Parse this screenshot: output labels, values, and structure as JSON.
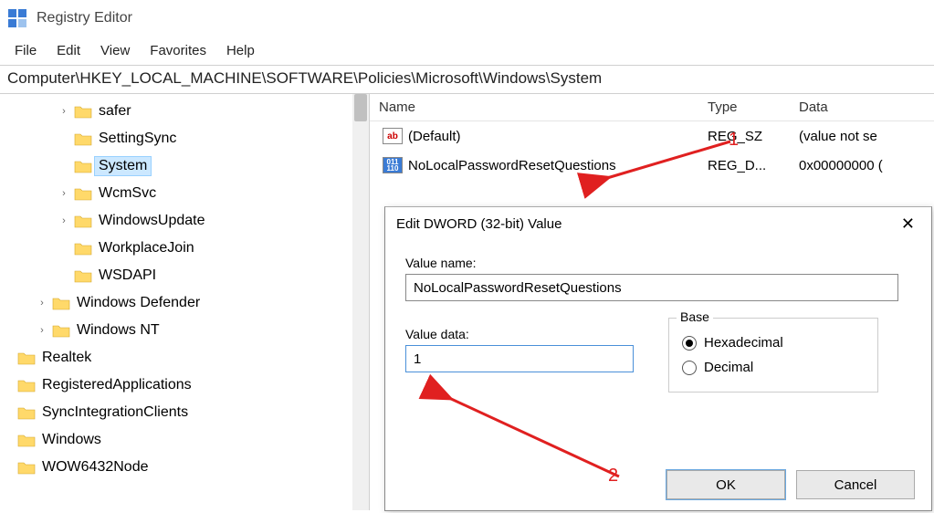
{
  "app": {
    "title": "Registry Editor"
  },
  "menu": [
    "File",
    "Edit",
    "View",
    "Favorites",
    "Help"
  ],
  "path": "Computer\\HKEY_LOCAL_MACHINE\\SOFTWARE\\Policies\\Microsoft\\Windows\\System",
  "tree": [
    {
      "indent": 62,
      "expand": "›",
      "label": "safer"
    },
    {
      "indent": 62,
      "expand": "",
      "label": "SettingSync"
    },
    {
      "indent": 62,
      "expand": "",
      "label": "System",
      "selected": true
    },
    {
      "indent": 62,
      "expand": "›",
      "label": "WcmSvc"
    },
    {
      "indent": 62,
      "expand": "›",
      "label": "WindowsUpdate"
    },
    {
      "indent": 62,
      "expand": "",
      "label": "WorkplaceJoin"
    },
    {
      "indent": 62,
      "expand": "",
      "label": "WSDAPI"
    },
    {
      "indent": 38,
      "expand": "›",
      "label": "Windows Defender"
    },
    {
      "indent": 38,
      "expand": "›",
      "label": "Windows NT"
    },
    {
      "indent": 0,
      "expand": "",
      "label": "Realtek"
    },
    {
      "indent": 0,
      "expand": "",
      "label": "RegisteredApplications"
    },
    {
      "indent": 0,
      "expand": "",
      "label": "SyncIntegrationClients"
    },
    {
      "indent": 0,
      "expand": "",
      "label": "Windows"
    },
    {
      "indent": 0,
      "expand": "",
      "label": "WOW6432Node"
    }
  ],
  "list": {
    "headers": {
      "name": "Name",
      "type": "Type",
      "data": "Data"
    },
    "rows": [
      {
        "icon": "ab",
        "name": "(Default)",
        "type": "REG_SZ",
        "data": "(value not se"
      },
      {
        "icon": "num",
        "name": "NoLocalPasswordResetQuestions",
        "type": "REG_D...",
        "data": "0x00000000 ("
      }
    ]
  },
  "dialog": {
    "title": "Edit DWORD (32-bit) Value",
    "valueNameLabel": "Value name:",
    "valueName": "NoLocalPasswordResetQuestions",
    "valueDataLabel": "Value data:",
    "valueData": "1",
    "baseLabel": "Base",
    "hexLabel": "Hexadecimal",
    "decLabel": "Decimal",
    "baseSelected": "hex",
    "ok": "OK",
    "cancel": "Cancel"
  },
  "annotations": {
    "one": "1",
    "two": "2"
  }
}
